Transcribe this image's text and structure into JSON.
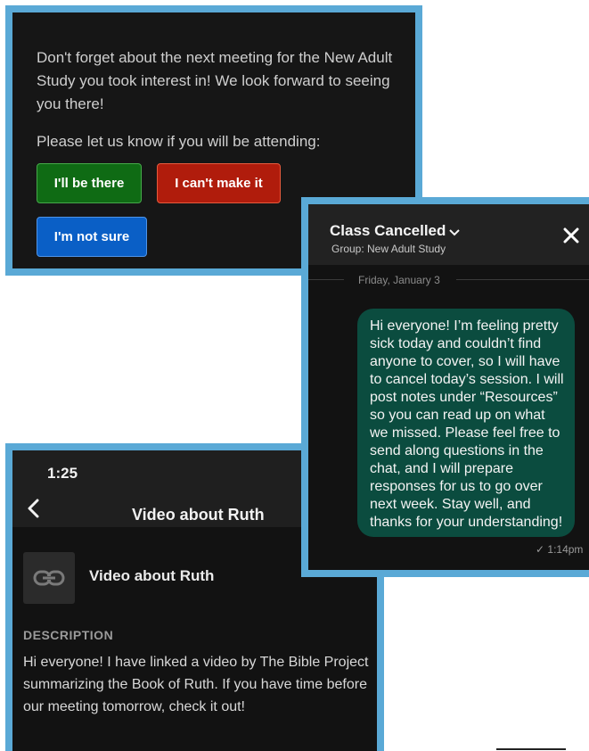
{
  "reminder": {
    "message": "Don't forget about the next meeting for the New Adult Study you took interest in! We look forward to seeing you there!",
    "prompt": "Please let us know if you will be attending:",
    "buttons": {
      "attending": "I'll be there",
      "not_attending": "I can't make it",
      "unsure": "I'm not sure"
    },
    "colors": {
      "attending": "#0f6b14",
      "not_attending": "#b01c0c",
      "unsure": "#0a5fc6"
    }
  },
  "chat": {
    "title": "Class Cancelled",
    "group": "Group: New Adult Study",
    "date_divider": "Friday, January 3",
    "message": "Hi everyone! I’m feeling pretty sick today and couldn’t find anyone to cover, so I will have to cancel today’s session. I will post notes under “Resources” so you can read up on what we missed. Please feel free to send along questions in the chat, and I will prepare responses for us to go over next week. Stay well, and thanks for your understanding!",
    "timestamp": "✓ 1:14pm",
    "bubble_color": "#0b4c3f"
  },
  "resource": {
    "status_time": "1:25",
    "title": "Video about Ruth",
    "link_title": "Video about Ruth",
    "description_heading": "DESCRIPTION",
    "description": "Hi everyone! I have linked a video by The Bible Project summarizing the Book of Ruth. If you have time before our meeting tomorrow, check it out!"
  },
  "icons": [
    "chevron-down-icon",
    "close-icon",
    "back-chevron-icon",
    "link-icon"
  ],
  "accent_frame_color": "#5aa9d6"
}
